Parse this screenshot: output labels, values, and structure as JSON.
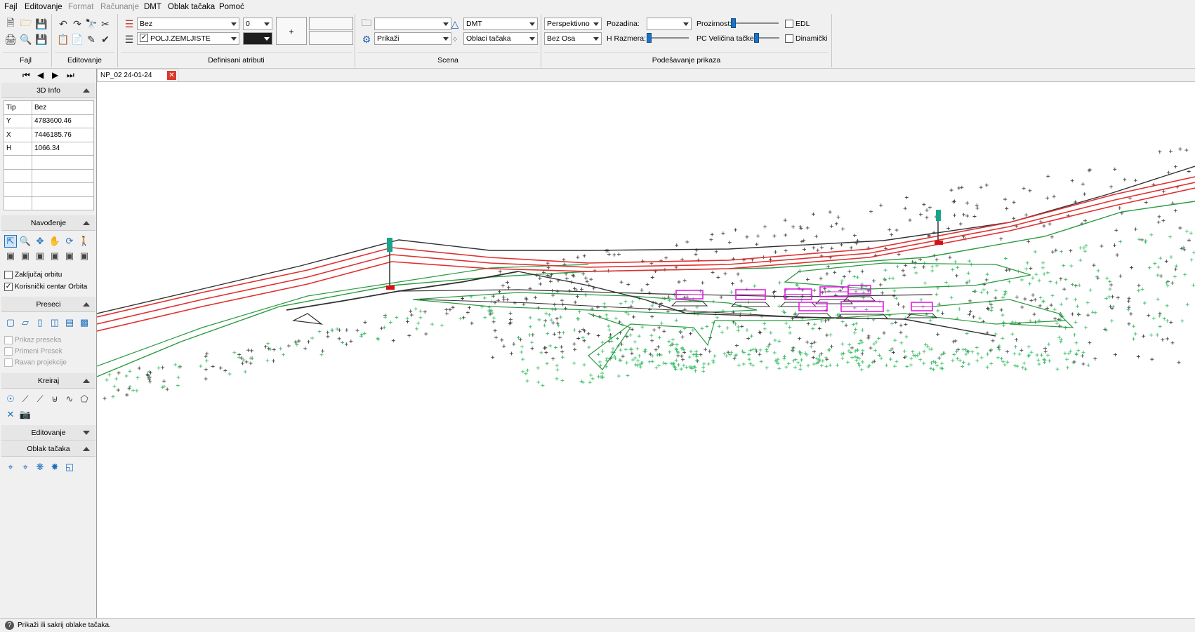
{
  "menu": [
    "Fajl",
    "Editovanje",
    "Format",
    "Računanje",
    "DMT",
    "Oblak tačaka",
    "Pomoć"
  ],
  "ribbon": {
    "groups": {
      "fajl": "Fajl",
      "editovanje": "Editovanje",
      "atributi": "Definisani atributi",
      "scena": "Scena",
      "prikaz": "Podešavanje prikaza"
    },
    "atributi": {
      "combo1": "Bez",
      "combo2": "POLJ.ZEMLJISTE",
      "combo3": "0",
      "plus": "+"
    },
    "scena": {
      "combo1": "",
      "combo2": "Prikaži",
      "dmt": "DMT",
      "oblaci": "Oblaci tačaka"
    },
    "prikaz": {
      "projection": "Perspektivno",
      "axes": "Bez Osa",
      "pozadina_label": "Pozadina:",
      "hrazmera_label": "H Razmera:",
      "prozirnost_label": "Prozirnost:",
      "pcvelicina_label": "PC Veličina tačke",
      "edl_label": "EDL",
      "dinamicki_label": "Dinamički"
    }
  },
  "left": {
    "info_title": "3D Info",
    "info_rows": [
      [
        "Tip",
        "Bez"
      ],
      [
        "Y",
        "4783600.46"
      ],
      [
        "X",
        "7446185.76"
      ],
      [
        "H",
        "1066.34"
      ],
      [
        "",
        ""
      ],
      [
        "",
        ""
      ],
      [
        "",
        ""
      ],
      [
        "",
        ""
      ]
    ],
    "navodjenje_title": "Navođenje",
    "zakljucaj": "Zaključaj orbitu",
    "korisnicki": "Korisnički centar Orbita",
    "preseci_title": "Preseci",
    "prikaz_preseka": "Prikaz preseka",
    "primeni_presek": "Primeni Presek",
    "ravan_projekcije": "Ravan projekcije",
    "kreiraj_title": "Kreiraj",
    "editovanje_title": "Editovanje",
    "oblak_title": "Oblak tačaka"
  },
  "tab": {
    "label": "NP_02 24-01-24"
  },
  "status": {
    "text": "Prikaži ili sakrij oblake tačaka."
  },
  "colors": {
    "road_red": "#e03030",
    "line_black": "#303030",
    "terrain_green": "#2a9a40",
    "points_green": "#3fc06a",
    "building_magenta": "#e020e0",
    "accent_blue": "#1a73c8"
  }
}
